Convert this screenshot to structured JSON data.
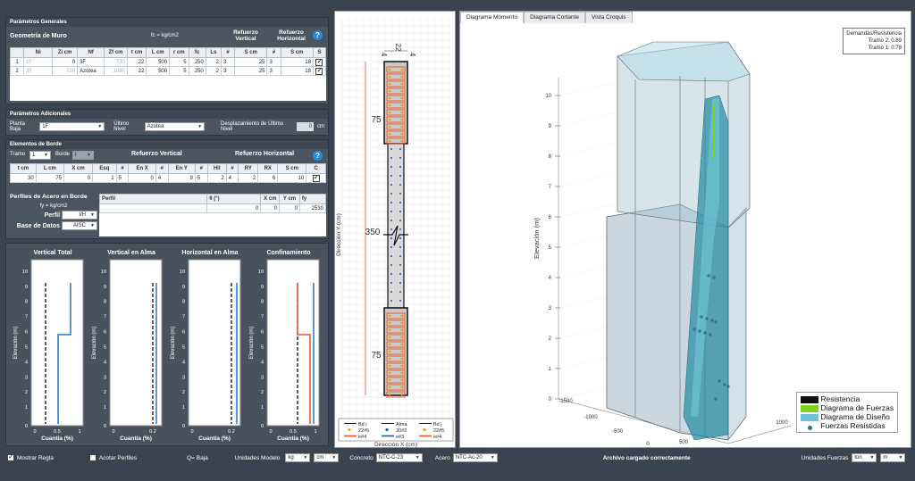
{
  "general": {
    "section_title": "Parámetros Generales",
    "heading": "Geometría de Muro",
    "fc_label": "fc = kg/cm2",
    "ref_vertical": "Refuerzo Vertical",
    "ref_horizontal": "Refuerzo Horizontal",
    "help": "?",
    "columns": [
      "",
      "Ni",
      "Zi cm",
      "Nf",
      "Zf cm",
      "t cm",
      "L cm",
      "r cm",
      "fc",
      "Ls",
      "#",
      "S cm",
      "#",
      "S cm",
      "S"
    ],
    "rows": [
      {
        "idx": "1",
        "ni": "1F",
        "zi": "0",
        "nf": "3F",
        "zf": "720",
        "t": "22",
        "l": "500",
        "r": "5",
        "fc": "250",
        "ls": "2",
        "n1": "3",
        "s1": "25",
        "n2": "3",
        "s2": "18"
      },
      {
        "idx": "2",
        "ni": "3F",
        "zi": "720",
        "nf": "Azotea",
        "zf": "1080",
        "t": "22",
        "l": "500",
        "r": "5",
        "fc": "250",
        "ls": "2",
        "n1": "3",
        "s1": "25",
        "n2": "3",
        "s2": "18"
      }
    ]
  },
  "additional": {
    "section_title": "Parámetros Adicionales",
    "planta_baja_label": "Planta Baja",
    "planta_baja": "1F",
    "ultimo_nivel_label": "Último Nivel",
    "ultimo_nivel": "Azotea",
    "desplazamiento_label": "Desplazamiento de Último Nivel",
    "desplazamiento": "0",
    "desplazamiento_unit": "cm"
  },
  "border": {
    "section_title": "Elementos de Borde",
    "tramo_label": "Tramo",
    "tramo": "1",
    "borde_label": "Borde",
    "borde": "I",
    "ref_vertical": "Refuerzo Vertical",
    "ref_horizontal": "Refuerzo Horizontal",
    "help": "?",
    "columns": [
      "t cm",
      "L cm",
      "X cm",
      "Esq",
      "#",
      "En X",
      "#",
      "En Y",
      "#",
      "Hil",
      "#",
      "RY",
      "RX",
      "S cm",
      "C"
    ],
    "row": [
      "30",
      "75",
      "0",
      "1",
      "5",
      "0",
      "4",
      "9",
      "5",
      "2",
      "4",
      "2",
      "6",
      "10"
    ],
    "perfiles_title": "Perfiles de Acero en Borde",
    "fy_label": "fy = kg/cm2",
    "perfil_label": "Perfil",
    "perfil": "I/H",
    "base_label": "Base de Datos",
    "base": "AISC",
    "perfil_columns": [
      "Perfil",
      "θ (°)",
      "X cm",
      "Y cm",
      "fy"
    ],
    "perfil_row": [
      "",
      "0",
      "0",
      "0",
      "2530"
    ]
  },
  "mini_charts": [
    {
      "title": "Vertical Total",
      "xlabel": "Cuantía (%)",
      "ylabel": "Elevación (m)",
      "xticks": [
        "0",
        "0.5",
        "1"
      ],
      "yticks": [
        "0",
        "1",
        "2",
        "3",
        "4",
        "5",
        "6",
        "7",
        "8",
        "9",
        "10"
      ]
    },
    {
      "title": "Vertical en Alma",
      "xlabel": "Cuantía (%)",
      "ylabel": "Elevación (m)",
      "xticks": [
        "0",
        "0.2"
      ],
      "yticks": [
        "0",
        "1",
        "2",
        "3",
        "4",
        "5",
        "6",
        "7",
        "8",
        "9",
        "10"
      ]
    },
    {
      "title": "Horizontal en Alma",
      "xlabel": "Cuantía (%)",
      "ylabel": "Elevación (m)",
      "xticks": [
        "0",
        "0.2"
      ],
      "yticks": [
        "0",
        "1",
        "2",
        "3",
        "4",
        "5",
        "6",
        "7",
        "8",
        "9",
        "10"
      ]
    },
    {
      "title": "Confinamiento",
      "xlabel": "Cuantía (%)",
      "ylabel": "Elevación (m)",
      "xticks": [
        "0",
        "0.5",
        "1"
      ],
      "yticks": [
        "0",
        "1",
        "2",
        "3",
        "4",
        "5",
        "6",
        "7",
        "8",
        "9",
        "10"
      ]
    }
  ],
  "section": {
    "dim_top": "22",
    "dim_top_left": "4",
    "dim_top_right": "4",
    "dim_75_top": "75",
    "dim_350": "350",
    "dim_75_bottom": "75",
    "ylabel": "Dirección Y (cm)",
    "xlabel": "Dirección X (cm)",
    "legend": [
      {
        "symbol": "line",
        "text": "Bd i"
      },
      {
        "symbol": "line",
        "text": "Alma"
      },
      {
        "symbol": "line",
        "text": "Bd j"
      },
      {
        "symbol": "dot-orange",
        "text": "22#5"
      },
      {
        "symbol": "dot-blue",
        "text": "30#3"
      },
      {
        "symbol": "dot-orange",
        "text": "22#5"
      },
      {
        "symbol": "line-orange",
        "text": "e#4"
      },
      {
        "symbol": "line-blue",
        "text": "e#3"
      },
      {
        "symbol": "line-orange",
        "text": "e#4"
      }
    ]
  },
  "diagram": {
    "tabs": [
      "Diagrama Momento",
      "Diagrama Cortante",
      "Vista Croquis"
    ],
    "box_title": "Demandas/Resistencia",
    "box_line1": "Tramo 2: 0.89",
    "box_line2": "Tramo 1: 0.78",
    "zlabel": "Elevación (m)",
    "zticks": [
      "0",
      "1",
      "2",
      "3",
      "4",
      "5",
      "6",
      "7",
      "8",
      "9",
      "10"
    ],
    "xticks": [
      "-1500",
      "-1000",
      "-500",
      "0",
      "500",
      "1000"
    ],
    "legend": [
      {
        "color": "#111111",
        "text": "Resistencia"
      },
      {
        "color": "#7ed321",
        "text": "Diagrama de Fuerzas"
      },
      {
        "color": "#6fc3d6",
        "text": "Diagrama de Diseño"
      },
      {
        "color": "#2d6f8e",
        "text": "Fuerzas Resistidas"
      }
    ]
  },
  "status": {
    "mostrar_regla": "Mostrar Regla",
    "acotar_perfiles": "Acotar Perfiles",
    "q": "Q= Baja",
    "unidades_modelo": "Unidades Modelo",
    "u1": "kg",
    "u2": "cm",
    "concreto_label": "Concreto",
    "concreto": "NTC-C-23",
    "acero_label": "Acero",
    "acero": "NTC-Ac-20",
    "message": "Archivo cargado correctamente",
    "unidades_fuerzas": "Unidades Fuerzas",
    "uf1": "ton",
    "uf2": "m"
  }
}
